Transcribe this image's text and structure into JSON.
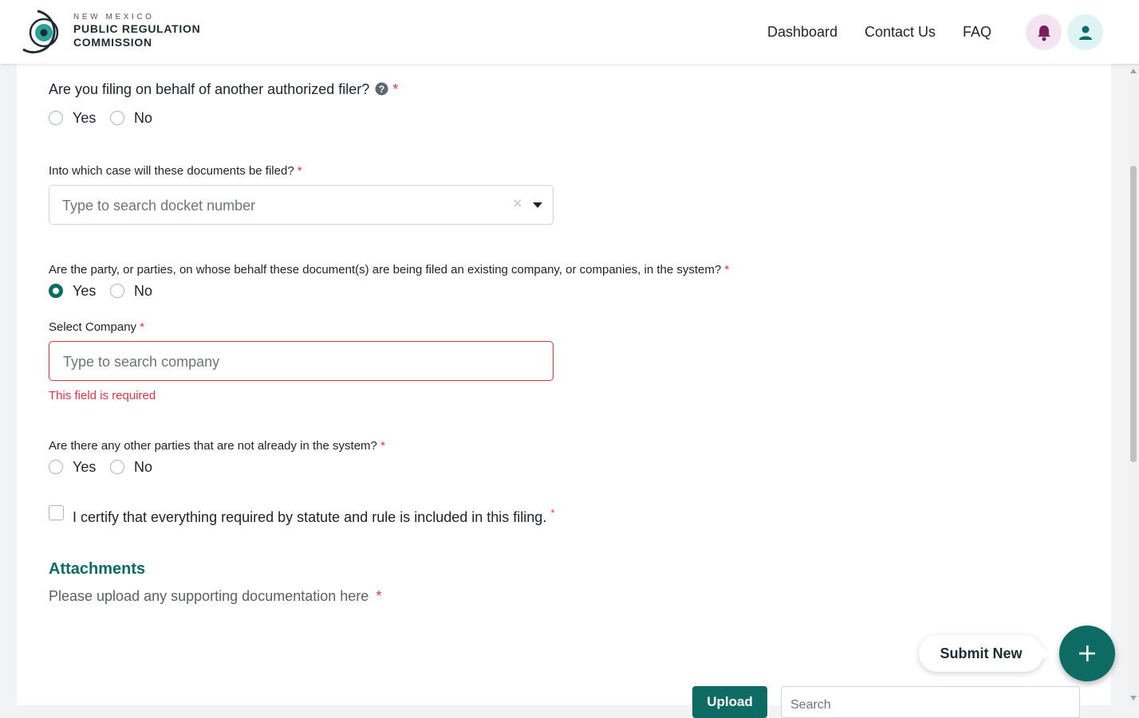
{
  "header": {
    "logo": {
      "line1": "NEW MEXICO",
      "line2": "PUBLIC REGULATION",
      "line3": "COMMISSION"
    },
    "nav": [
      {
        "label": "Dashboard"
      },
      {
        "label": "Contact Us"
      },
      {
        "label": "FAQ"
      }
    ],
    "icons": {
      "notifications": "bell-icon",
      "profile": "user-icon"
    },
    "colors": {
      "bell_bg": "#f3e5f0",
      "bell_icon": "#7b1f5e",
      "user_bg": "#def4f2",
      "user_icon": "#0d6b64"
    }
  },
  "form": {
    "q_behalf": {
      "label": "Are you filing on behalf of another authorized filer?",
      "required": "*",
      "yes": "Yes",
      "no": "No",
      "selected": "none"
    },
    "q_case": {
      "label": "Into which case will these documents be filed?",
      "required": "*",
      "placeholder": "Type to search docket number",
      "clear": "×"
    },
    "q_parties": {
      "label": "Are the party, or parties, on whose behalf these document(s) are being filed an existing company, or companies, in the system?",
      "required": "*",
      "yes": "Yes",
      "no": "No",
      "selected": "Yes"
    },
    "select_company": {
      "label": "Select Company",
      "required": "*",
      "placeholder": "Type to search company",
      "error": "This field is required"
    },
    "q_other": {
      "label": "Are there any other parties that are not already in the system?",
      "required": "*",
      "yes": "Yes",
      "no": "No",
      "selected": "none"
    },
    "certify": {
      "label": "I certify that everything required by statute and rule is included in this filing.",
      "required": "*",
      "checked": false
    },
    "attachments": {
      "title": "Attachments",
      "text": "Please upload any supporting documentation here",
      "required": "*"
    }
  },
  "actions": {
    "submit_new": "Submit New",
    "fab_icon": "plus-icon",
    "upload": "Upload",
    "search_placeholder": "Search"
  },
  "colors": {
    "accent": "#0d6b64",
    "error": "#dc3545"
  }
}
